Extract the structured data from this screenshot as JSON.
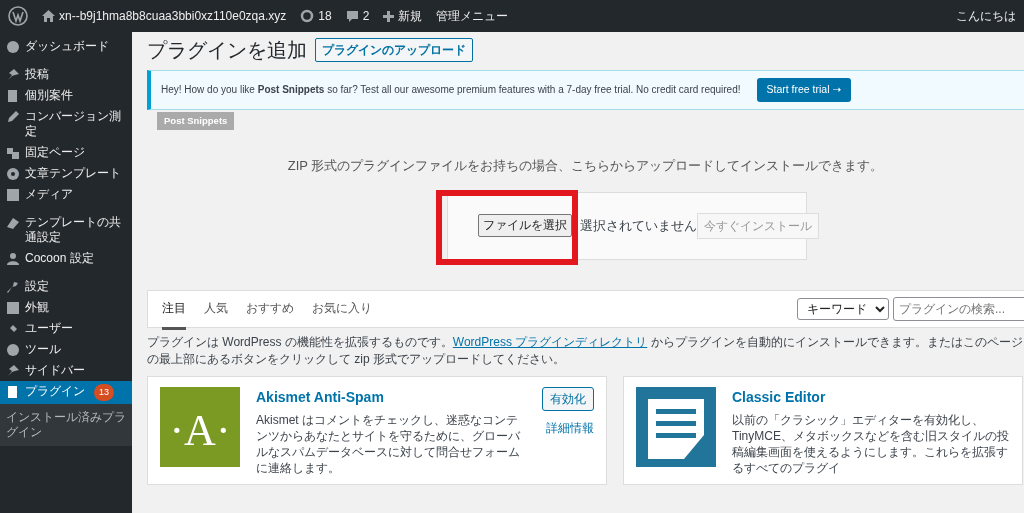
{
  "admin_bar": {
    "site": "xn--b9j1hma8b8cuaa3bbi0xz110e0zqa.xyz",
    "updates": "18",
    "comments": "2",
    "new": "新規",
    "admin_menu": "管理メニュー",
    "greeting": "こんにちは"
  },
  "sidebar": {
    "sections": [
      {
        "items": [
          {
            "label": "ダッシュボード",
            "selected": false
          }
        ]
      },
      {
        "items": [
          {
            "label": "投稿",
            "selected": false
          },
          {
            "label": "個別案件",
            "selected": false
          },
          {
            "label": "コンバージョン測定",
            "selected": false
          },
          {
            "label": "固定ページ",
            "selected": false
          },
          {
            "label": "文章テンプレート",
            "selected": false
          },
          {
            "label": "メディア",
            "selected": false
          }
        ]
      },
      {
        "items": [
          {
            "label": "テンプレートの共通設定",
            "selected": false
          },
          {
            "label": "Cocoon 設定",
            "selected": false
          }
        ]
      },
      {
        "items": [
          {
            "label": "設定",
            "selected": false
          },
          {
            "label": "外観",
            "selected": false
          },
          {
            "label": "ユーザー",
            "selected": false
          },
          {
            "label": "ツール",
            "selected": false
          },
          {
            "label": "サイドバー",
            "selected": false
          },
          {
            "label": "プラグイン",
            "selected": true,
            "badge": "13"
          }
        ]
      }
    ],
    "submenu": [
      {
        "label": "インストール済みプラグイン",
        "selected": false
      }
    ]
  },
  "page": {
    "title": "プラグインを追加",
    "upload_button": "プラグインのアップロード"
  },
  "notice": {
    "text": "Hey! How do you like **Post Snippets** so far? Test all our awesome premium features with a 7-day free trial. No credit card required!",
    "button": "Start free trial ➝",
    "tag": "Post Snippets"
  },
  "upload": {
    "help": "ZIP 形式のプラグインファイルをお持ちの場合、こちらからアップロードしてインストールできます。",
    "choose_button": "ファイルを選択",
    "file_status": "選択されていません",
    "install_button": "今すぐインストール",
    "install_disabled": true
  },
  "filter": {
    "tabs": [
      {
        "label": "注目",
        "selected": true
      },
      {
        "label": "人気",
        "selected": false
      },
      {
        "label": "おすすめ",
        "selected": false
      },
      {
        "label": "お気に入り",
        "selected": false
      }
    ],
    "search_type": "キーワード",
    "search_placeholder": "プラグインの検索..."
  },
  "intro": {
    "before": "プラグインは WordPress の機能性を拡張するものです。",
    "link": "WordPress プラグインディレクトリ",
    "after": "からプラグインを自動的にインストールできます。またはこのページの最上部にあるボタンをクリックして zip 形式でアップロードしてください。"
  },
  "plugins": [
    {
      "kind": "letter",
      "icon_text": "·A·",
      "name": "Akismet Anti-Spam",
      "description": "Akismet はコメントをチェックし、迷惑なコンテンツからあなたとサイトを守るために、グローバルなスパムデータベースに対して問合せフォームに連絡します。",
      "button": "有効化",
      "details": "詳細情報"
    },
    {
      "kind": "document",
      "name": "Classic Editor",
      "description": "以前の「クラシック」エディターを有効化し、TinyMCE、メタボックスなどを含む旧スタイルの投稿編集画面を使えるようにします。これらを拡張するすべてのプラグイ"
    }
  ]
}
